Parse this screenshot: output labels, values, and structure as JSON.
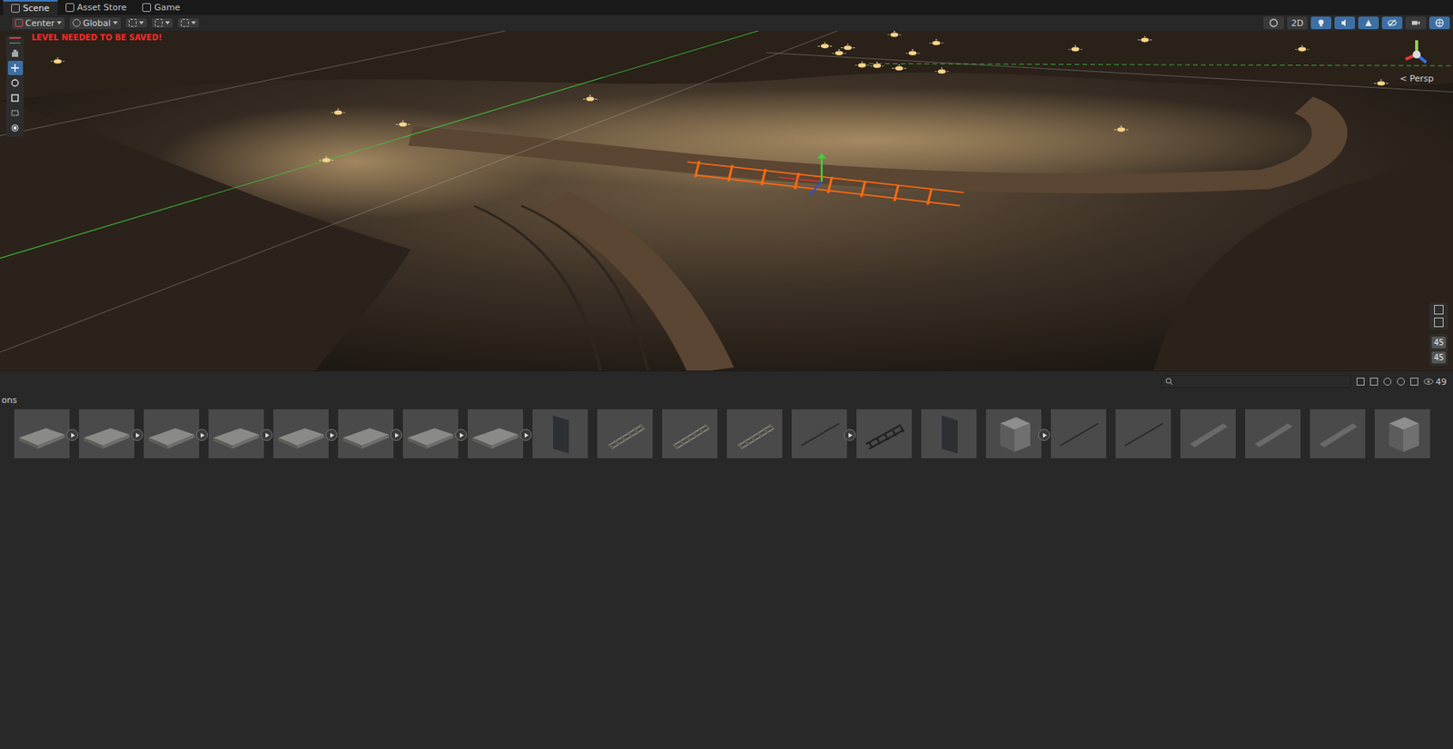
{
  "window": {
    "title": "Scene"
  },
  "tabs": [
    {
      "label": "Scene",
      "selected": true
    },
    {
      "label": "Asset Store",
      "selected": false
    },
    {
      "label": "Game",
      "selected": false
    }
  ],
  "toolbar": {
    "pivot": "Center",
    "space": "Global",
    "view_toggles": [
      {
        "kind": "shading",
        "label": "",
        "on": false
      },
      {
        "kind": "mode2d",
        "label": "2D",
        "on": false
      },
      {
        "kind": "light",
        "label": "",
        "on": true
      },
      {
        "kind": "audio",
        "label": "",
        "on": true
      },
      {
        "kind": "effects",
        "label": "",
        "on": true
      },
      {
        "kind": "visibility",
        "label": "",
        "on": true
      },
      {
        "kind": "camera",
        "label": "",
        "on": false
      },
      {
        "kind": "gizmos",
        "label": "",
        "on": true
      }
    ]
  },
  "scene": {
    "warning": "LEVEL NEEDED TO BE SAVED!",
    "projection": "< Persp",
    "tools": [
      {
        "kind": "hand",
        "selected": false
      },
      {
        "kind": "move",
        "selected": true
      },
      {
        "kind": "rotate",
        "selected": false
      },
      {
        "kind": "scale",
        "selected": false
      },
      {
        "kind": "rect",
        "selected": false
      },
      {
        "kind": "transform",
        "selected": false
      }
    ],
    "overlay_counters": [
      "45",
      "45"
    ]
  },
  "bottom": {
    "panel_label": "ons",
    "count": "49",
    "thumbnails": [
      {
        "kind": "tile",
        "expandable": true
      },
      {
        "kind": "tile",
        "expandable": true
      },
      {
        "kind": "tile",
        "expandable": true
      },
      {
        "kind": "tile",
        "expandable": true
      },
      {
        "kind": "tile",
        "expandable": true
      },
      {
        "kind": "tile",
        "expandable": true
      },
      {
        "kind": "tile",
        "expandable": true
      },
      {
        "kind": "tile",
        "expandable": true
      },
      {
        "kind": "panel",
        "expandable": false
      },
      {
        "kind": "rail",
        "expandable": false
      },
      {
        "kind": "rail",
        "expandable": false
      },
      {
        "kind": "rail",
        "expandable": false
      },
      {
        "kind": "rod",
        "expandable": true
      },
      {
        "kind": "ladder",
        "expandable": false
      },
      {
        "kind": "panel",
        "expandable": false
      },
      {
        "kind": "block",
        "expandable": true
      },
      {
        "kind": "rod",
        "expandable": false
      },
      {
        "kind": "rod",
        "expandable": false
      },
      {
        "kind": "plank",
        "expandable": false
      },
      {
        "kind": "plank",
        "expandable": false
      },
      {
        "kind": "plank",
        "expandable": false
      },
      {
        "kind": "block",
        "expandable": false
      }
    ]
  }
}
